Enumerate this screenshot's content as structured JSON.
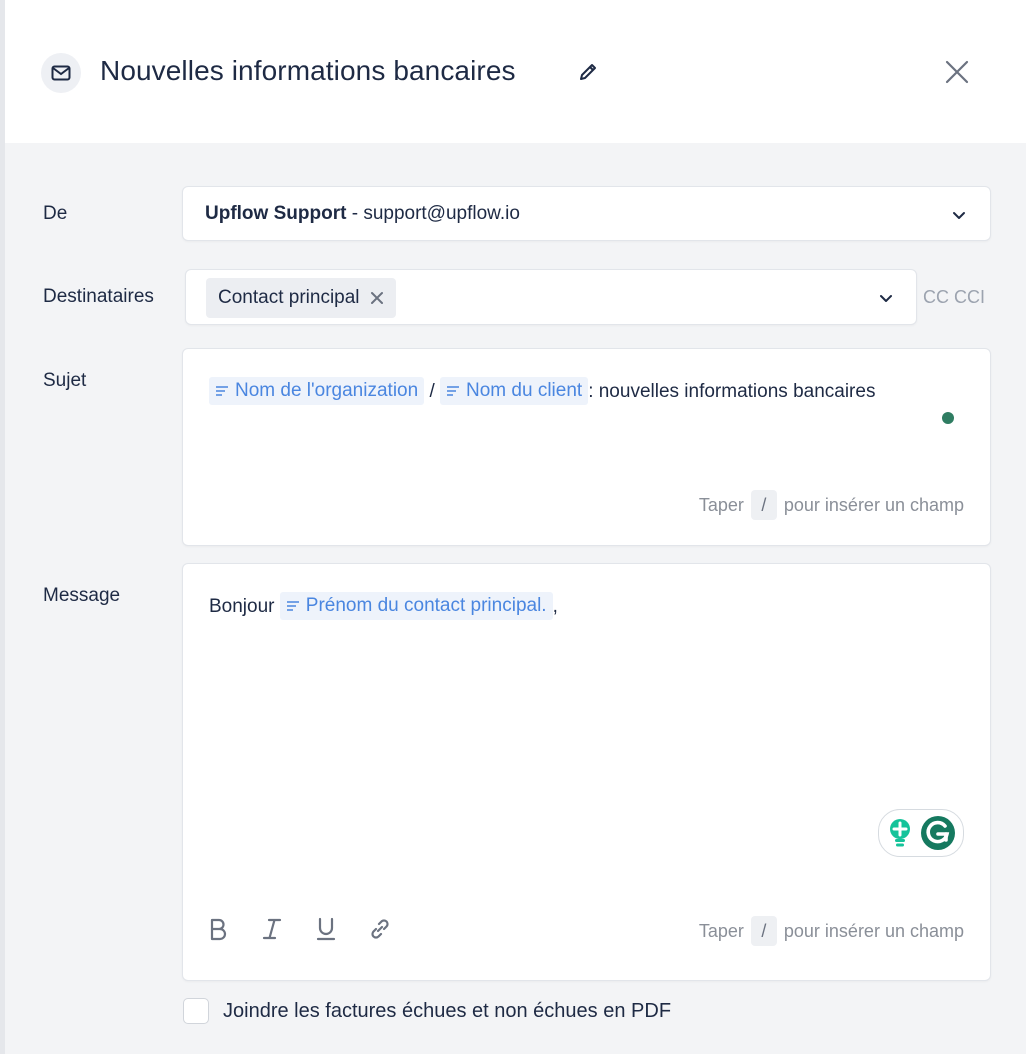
{
  "dialog": {
    "title": "Nouvelles informations bancaires"
  },
  "from": {
    "label": "De",
    "sender_name": "Upflow Support",
    "separator": " - ",
    "sender_email": "support@upflow.io"
  },
  "recipients": {
    "label": "Destinataires",
    "chip": "Contact principal",
    "cc": "CC",
    "bcc": "CCI"
  },
  "subject": {
    "label": "Sujet",
    "token_org": "Nom de l'organization",
    "slash": " / ",
    "token_client": "Nom du client",
    "text": ": nouvelles informations bancaires",
    "hint_before": "Taper",
    "hint_key": "/",
    "hint_after": "pour insérer un champ"
  },
  "message": {
    "label": "Message",
    "greeting": "Bonjour",
    "token_contact": "Prénom du contact principal.",
    "punctuation": ",",
    "hint_before": "Taper",
    "hint_key": "/",
    "hint_after": "pour insérer un champ"
  },
  "attachment": {
    "label": "Joindre les factures échues et non échues en PDF"
  },
  "colors": {
    "accent_token": "#4a86e0",
    "status_dot": "#2f7d62",
    "grammarly": "#15c39a"
  }
}
